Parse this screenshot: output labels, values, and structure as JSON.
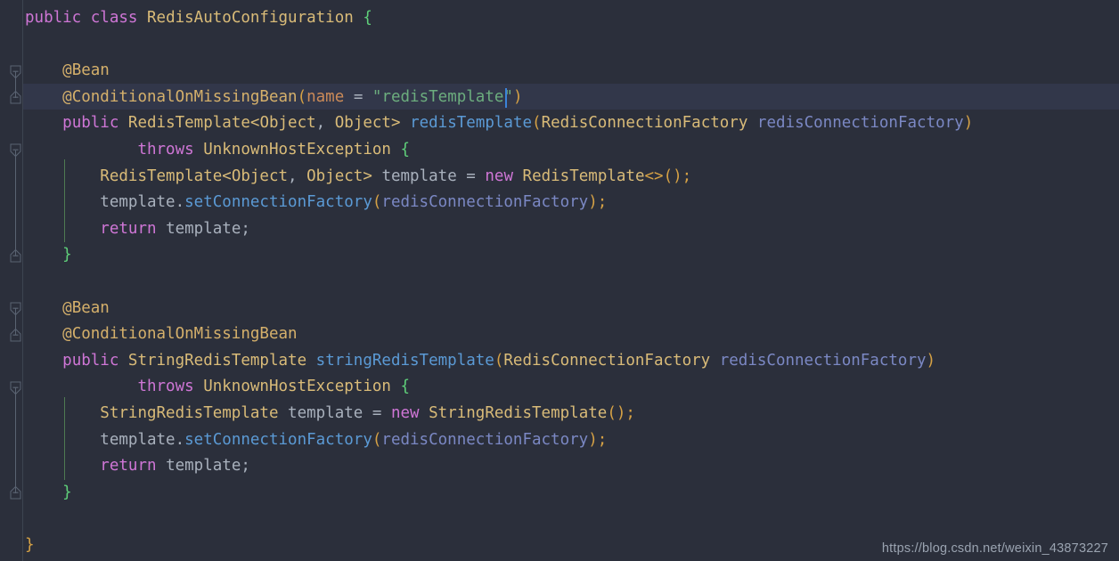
{
  "editor": {
    "theme_name": "darcula",
    "background": "#2b2f3b",
    "gutter_background": "#2b2f3b",
    "current_line_background": "#32374a",
    "caret_color": "#3b83d8",
    "default_text_color": "#a9b1bd",
    "font_size_px": 17.5,
    "line_height_px": 29.6,
    "language": "java",
    "current_line_index": 2,
    "caret": {
      "line_index": 2,
      "column_after_text": "@ConditionalOnMissingBean(name = \"redisTemplate"
    }
  },
  "colors": {
    "keyword": "#cf76d6",
    "annotation": "#d5b06b",
    "type": "#d9bb78",
    "method": "#5b9ad5",
    "parameter": "#7b88c4",
    "string": "#6cad7e",
    "attribute_name": "#cc8b58",
    "paren_matched": "#d5a145",
    "brace_highlight": "#5fd07a",
    "indent_guide": "#3d4450",
    "indent_guide_active": "#4e7a52",
    "fold_marker": "#5a6372",
    "gutter_divider": "#3d4450"
  },
  "clipped_top_line": {
    "text": ""
  },
  "code_lines": [
    {
      "index": 0,
      "plain": "public class RedisAutoConfiguration {",
      "tokens": [
        {
          "t": "public",
          "c": "kw"
        },
        {
          "t": " ",
          "c": "punct"
        },
        {
          "t": "class",
          "c": "kw"
        },
        {
          "t": " ",
          "c": "punct"
        },
        {
          "t": "RedisAutoConfiguration",
          "c": "type"
        },
        {
          "t": " ",
          "c": "punct"
        },
        {
          "t": "{",
          "c": "brace-hl"
        }
      ]
    },
    {
      "index": 1,
      "plain": "",
      "tokens": []
    },
    {
      "index": 2,
      "plain": "    @Bean",
      "tokens": [
        {
          "t": "    ",
          "c": "punct"
        },
        {
          "t": "@Bean",
          "c": "anno"
        }
      ]
    },
    {
      "index": 3,
      "plain": "    @ConditionalOnMissingBean(name = \"redisTemplate\")",
      "tokens": [
        {
          "t": "    ",
          "c": "punct"
        },
        {
          "t": "@ConditionalOnMissingBean",
          "c": "anno"
        },
        {
          "t": "(",
          "c": "paren"
        },
        {
          "t": "name",
          "c": "attr"
        },
        {
          "t": " ",
          "c": "punct"
        },
        {
          "t": "=",
          "c": "op"
        },
        {
          "t": " ",
          "c": "punct"
        },
        {
          "t": "\"redisTemplate\"",
          "c": "str"
        },
        {
          "t": ")",
          "c": "paren"
        }
      ]
    },
    {
      "index": 4,
      "plain": "    public RedisTemplate<Object, Object> redisTemplate(RedisConnectionFactory redisConnectionFactory)",
      "tokens": [
        {
          "t": "    ",
          "c": "punct"
        },
        {
          "t": "public",
          "c": "kw"
        },
        {
          "t": " ",
          "c": "punct"
        },
        {
          "t": "RedisTemplate",
          "c": "type"
        },
        {
          "t": "<",
          "c": "type"
        },
        {
          "t": "Object",
          "c": "type"
        },
        {
          "t": ",",
          "c": "punct"
        },
        {
          "t": " ",
          "c": "punct"
        },
        {
          "t": "Object",
          "c": "type"
        },
        {
          "t": ">",
          "c": "type"
        },
        {
          "t": " ",
          "c": "punct"
        },
        {
          "t": "redisTemplate",
          "c": "method"
        },
        {
          "t": "(",
          "c": "paren"
        },
        {
          "t": "RedisConnectionFactory",
          "c": "type"
        },
        {
          "t": " ",
          "c": "punct"
        },
        {
          "t": "redisConnectionFactory",
          "c": "param"
        },
        {
          "t": ")",
          "c": "paren"
        }
      ]
    },
    {
      "index": 5,
      "plain": "            throws UnknownHostException {",
      "tokens": [
        {
          "t": "            ",
          "c": "punct"
        },
        {
          "t": "throws",
          "c": "kw"
        },
        {
          "t": " ",
          "c": "punct"
        },
        {
          "t": "UnknownHostException",
          "c": "type"
        },
        {
          "t": " ",
          "c": "punct"
        },
        {
          "t": "{",
          "c": "brace-hl"
        }
      ]
    },
    {
      "index": 6,
      "plain": "        RedisTemplate<Object, Object> template = new RedisTemplate<>();",
      "tokens": [
        {
          "t": "        ",
          "c": "punct"
        },
        {
          "t": "RedisTemplate",
          "c": "type"
        },
        {
          "t": "<",
          "c": "type"
        },
        {
          "t": "Object",
          "c": "type"
        },
        {
          "t": ",",
          "c": "punct"
        },
        {
          "t": " ",
          "c": "punct"
        },
        {
          "t": "Object",
          "c": "type"
        },
        {
          "t": ">",
          "c": "type"
        },
        {
          "t": " ",
          "c": "punct"
        },
        {
          "t": "template",
          "c": "ident"
        },
        {
          "t": " ",
          "c": "punct"
        },
        {
          "t": "=",
          "c": "op"
        },
        {
          "t": " ",
          "c": "punct"
        },
        {
          "t": "new",
          "c": "kw"
        },
        {
          "t": " ",
          "c": "punct"
        },
        {
          "t": "RedisTemplate",
          "c": "type"
        },
        {
          "t": "<>",
          "c": "diamond"
        },
        {
          "t": "()",
          "c": "paren"
        },
        {
          "t": ";",
          "c": "paren"
        }
      ]
    },
    {
      "index": 7,
      "plain": "        template.setConnectionFactory(redisConnectionFactory);",
      "tokens": [
        {
          "t": "        ",
          "c": "punct"
        },
        {
          "t": "template",
          "c": "ident"
        },
        {
          "t": ".",
          "c": "punct"
        },
        {
          "t": "setConnectionFactory",
          "c": "method"
        },
        {
          "t": "(",
          "c": "paren"
        },
        {
          "t": "redisConnectionFactory",
          "c": "param"
        },
        {
          "t": ")",
          "c": "paren"
        },
        {
          "t": ";",
          "c": "paren"
        }
      ]
    },
    {
      "index": 8,
      "plain": "        return template;",
      "tokens": [
        {
          "t": "        ",
          "c": "punct"
        },
        {
          "t": "return",
          "c": "kw"
        },
        {
          "t": " ",
          "c": "punct"
        },
        {
          "t": "template",
          "c": "ident"
        },
        {
          "t": ";",
          "c": "punct"
        }
      ]
    },
    {
      "index": 9,
      "plain": "    }",
      "tokens": [
        {
          "t": "    ",
          "c": "punct"
        },
        {
          "t": "}",
          "c": "brace-hl"
        }
      ]
    },
    {
      "index": 10,
      "plain": "",
      "tokens": []
    },
    {
      "index": 11,
      "plain": "    @Bean",
      "tokens": [
        {
          "t": "    ",
          "c": "punct"
        },
        {
          "t": "@Bean",
          "c": "anno"
        }
      ]
    },
    {
      "index": 12,
      "plain": "    @ConditionalOnMissingBean",
      "tokens": [
        {
          "t": "    ",
          "c": "punct"
        },
        {
          "t": "@ConditionalOnMissingBean",
          "c": "anno"
        }
      ]
    },
    {
      "index": 13,
      "plain": "    public StringRedisTemplate stringRedisTemplate(RedisConnectionFactory redisConnectionFactory)",
      "tokens": [
        {
          "t": "    ",
          "c": "punct"
        },
        {
          "t": "public",
          "c": "kw"
        },
        {
          "t": " ",
          "c": "punct"
        },
        {
          "t": "StringRedisTemplate",
          "c": "type"
        },
        {
          "t": " ",
          "c": "punct"
        },
        {
          "t": "stringRedisTemplate",
          "c": "method"
        },
        {
          "t": "(",
          "c": "paren"
        },
        {
          "t": "RedisConnectionFactory",
          "c": "type"
        },
        {
          "t": " ",
          "c": "punct"
        },
        {
          "t": "redisConnectionFactory",
          "c": "param"
        },
        {
          "t": ")",
          "c": "paren"
        }
      ]
    },
    {
      "index": 14,
      "plain": "            throws UnknownHostException {",
      "tokens": [
        {
          "t": "            ",
          "c": "punct"
        },
        {
          "t": "throws",
          "c": "kw"
        },
        {
          "t": " ",
          "c": "punct"
        },
        {
          "t": "UnknownHostException",
          "c": "type"
        },
        {
          "t": " ",
          "c": "punct"
        },
        {
          "t": "{",
          "c": "brace-hl"
        }
      ]
    },
    {
      "index": 15,
      "plain": "        StringRedisTemplate template = new StringRedisTemplate();",
      "tokens": [
        {
          "t": "        ",
          "c": "punct"
        },
        {
          "t": "StringRedisTemplate",
          "c": "type"
        },
        {
          "t": " ",
          "c": "punct"
        },
        {
          "t": "template",
          "c": "ident"
        },
        {
          "t": " ",
          "c": "punct"
        },
        {
          "t": "=",
          "c": "op"
        },
        {
          "t": " ",
          "c": "punct"
        },
        {
          "t": "new",
          "c": "kw"
        },
        {
          "t": " ",
          "c": "punct"
        },
        {
          "t": "StringRedisTemplate",
          "c": "type"
        },
        {
          "t": "()",
          "c": "paren"
        },
        {
          "t": ";",
          "c": "paren"
        }
      ]
    },
    {
      "index": 16,
      "plain": "        template.setConnectionFactory(redisConnectionFactory);",
      "tokens": [
        {
          "t": "        ",
          "c": "punct"
        },
        {
          "t": "template",
          "c": "ident"
        },
        {
          "t": ".",
          "c": "punct"
        },
        {
          "t": "setConnectionFactory",
          "c": "method"
        },
        {
          "t": "(",
          "c": "paren"
        },
        {
          "t": "redisConnectionFactory",
          "c": "param"
        },
        {
          "t": ")",
          "c": "paren"
        },
        {
          "t": ";",
          "c": "paren"
        }
      ]
    },
    {
      "index": 17,
      "plain": "        return template;",
      "tokens": [
        {
          "t": "        ",
          "c": "punct"
        },
        {
          "t": "return",
          "c": "kw"
        },
        {
          "t": " ",
          "c": "punct"
        },
        {
          "t": "template",
          "c": "ident"
        },
        {
          "t": ";",
          "c": "punct"
        }
      ]
    },
    {
      "index": 18,
      "plain": "    }",
      "tokens": [
        {
          "t": "    ",
          "c": "punct"
        },
        {
          "t": "}",
          "c": "brace-hl"
        }
      ]
    },
    {
      "index": 19,
      "plain": "",
      "tokens": []
    },
    {
      "index": 20,
      "plain": "}",
      "tokens": [
        {
          "t": "}",
          "c": "paren"
        }
      ]
    }
  ],
  "fold_markers": [
    {
      "line_index": 2,
      "direction": "down",
      "glyph": "minus",
      "label": "collapse-region-start"
    },
    {
      "line_index": 3,
      "direction": "up",
      "glyph": "minus",
      "label": "collapse-region-end"
    },
    {
      "line_index": 5,
      "direction": "down",
      "glyph": "minus",
      "label": "collapse-method-body-start"
    },
    {
      "line_index": 9,
      "direction": "up",
      "glyph": "minus",
      "label": "collapse-method-body-end"
    },
    {
      "line_index": 11,
      "direction": "down",
      "glyph": "minus",
      "label": "collapse-region-start"
    },
    {
      "line_index": 12,
      "direction": "up",
      "glyph": "minus",
      "label": "collapse-region-end"
    },
    {
      "line_index": 14,
      "direction": "down",
      "glyph": "minus",
      "label": "collapse-method-body-start"
    },
    {
      "line_index": 18,
      "direction": "up",
      "glyph": "minus",
      "label": "collapse-method-body-end"
    }
  ],
  "fold_rails": [
    {
      "from_line": 2,
      "to_line": 3
    },
    {
      "from_line": 5,
      "to_line": 9
    },
    {
      "from_line": 11,
      "to_line": 12
    },
    {
      "from_line": 14,
      "to_line": 18
    }
  ],
  "indent_guides": [
    {
      "column": 1,
      "from_line": 6,
      "to_line": 9,
      "active": true
    },
    {
      "column": 1,
      "from_line": 15,
      "to_line": 18,
      "active": true
    }
  ],
  "watermark": {
    "text": "https://blog.csdn.net/weixin_43873227"
  }
}
